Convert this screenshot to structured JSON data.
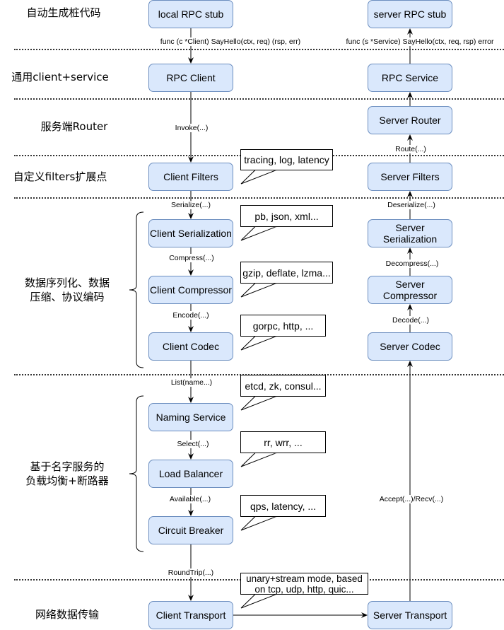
{
  "diagram": {
    "colors": {
      "node_fill": "#dae8fc",
      "node_stroke": "#6c8ebf",
      "line": "#000000",
      "separator": "#333333"
    },
    "layers": [
      {
        "id": "stub",
        "label": "自动生成桩代码"
      },
      {
        "id": "client_service",
        "label": "通用client+service"
      },
      {
        "id": "router",
        "label": "服务端Router"
      },
      {
        "id": "filters",
        "label": "自定义filters扩展点"
      },
      {
        "id": "codec",
        "label": "数据序列化、数据\n压缩、协议编码"
      },
      {
        "id": "naming",
        "label": "基于名字服务的\n负载均衡+断路器"
      },
      {
        "id": "transport",
        "label": "网络数据传输"
      }
    ],
    "client_nodes": [
      {
        "id": "local_stub",
        "label": "local RPC stub"
      },
      {
        "id": "rpc_client",
        "label": "RPC Client"
      },
      {
        "id": "client_filters",
        "label": "Client Filters"
      },
      {
        "id": "client_serialization",
        "label": "Client Serialization"
      },
      {
        "id": "client_compressor",
        "label": "Client Compressor"
      },
      {
        "id": "client_codec",
        "label": "Client Codec"
      },
      {
        "id": "naming_service",
        "label": "Naming Service"
      },
      {
        "id": "load_balancer",
        "label": "Load Balancer"
      },
      {
        "id": "circuit_breaker",
        "label": "Circuit Breaker"
      },
      {
        "id": "client_transport",
        "label": "Client Transport"
      }
    ],
    "server_nodes": [
      {
        "id": "server_stub",
        "label": "server RPC stub"
      },
      {
        "id": "rpc_service",
        "label": "RPC Service"
      },
      {
        "id": "server_router",
        "label": "Server Router"
      },
      {
        "id": "server_filters",
        "label": "Server Filters"
      },
      {
        "id": "server_serialization",
        "label": "Server\nSerialization"
      },
      {
        "id": "server_compressor",
        "label": "Server\nCompressor"
      },
      {
        "id": "server_codec",
        "label": "Server Codec"
      },
      {
        "id": "server_transport",
        "label": "Server Transport"
      }
    ],
    "client_edges": [
      {
        "from": "local_stub",
        "to": "rpc_client",
        "label": "func (c *Client) SayHello(ctx, req) (rsp, err)"
      },
      {
        "from": "rpc_client",
        "to": "client_filters",
        "label": "Invoke(...)"
      },
      {
        "from": "client_filters",
        "to": "client_serialization",
        "label": "Serialize(...)"
      },
      {
        "from": "client_serialization",
        "to": "client_compressor",
        "label": "Compress(...)"
      },
      {
        "from": "client_compressor",
        "to": "client_codec",
        "label": "Encode(...)"
      },
      {
        "from": "client_codec",
        "to": "naming_service",
        "label": "List(name...)"
      },
      {
        "from": "naming_service",
        "to": "load_balancer",
        "label": "Select(...)"
      },
      {
        "from": "load_balancer",
        "to": "circuit_breaker",
        "label": "Available(...)"
      },
      {
        "from": "circuit_breaker",
        "to": "client_transport",
        "label": "RoundTrip(...)"
      }
    ],
    "server_edges": [
      {
        "from": "server_transport",
        "to": "server_codec",
        "label": "Accept(...)/Recv(...)"
      },
      {
        "from": "server_codec",
        "to": "server_compressor",
        "label": "Decode(...)"
      },
      {
        "from": "server_compressor",
        "to": "server_serialization",
        "label": "Decompress(...)"
      },
      {
        "from": "server_serialization",
        "to": "server_filters",
        "label": "Deserialize(...)"
      },
      {
        "from": "server_filters",
        "to": "server_router",
        "label": "Route(...)"
      },
      {
        "from": "server_router",
        "to": "rpc_service",
        "label": ""
      },
      {
        "from": "rpc_service",
        "to": "server_stub",
        "label": "func (s *Service) SayHello(ctx, req, rsp) error"
      }
    ],
    "cross_edge": {
      "from": "client_transport",
      "to": "server_transport",
      "label": ""
    },
    "callouts": [
      {
        "target": "client_filters",
        "text": "tracing, log, latency"
      },
      {
        "target": "client_serialization",
        "text": "pb, json, xml..."
      },
      {
        "target": "client_compressor",
        "text": "gzip, deflate, lzma..."
      },
      {
        "target": "client_codec",
        "text": "gorpc, http, ..."
      },
      {
        "target": "naming_service",
        "text": "etcd, zk, consul..."
      },
      {
        "target": "load_balancer",
        "text": "rr, wrr, ..."
      },
      {
        "target": "circuit_breaker",
        "text": "qps, latency, ..."
      },
      {
        "target": "client_transport",
        "text": "unary+stream mode,  based\non tcp, udp, http, quic..."
      }
    ],
    "braces": [
      {
        "layer": "codec",
        "spans": [
          "client_serialization",
          "client_codec"
        ]
      },
      {
        "layer": "naming",
        "spans": [
          "naming_service",
          "circuit_breaker"
        ]
      }
    ]
  }
}
